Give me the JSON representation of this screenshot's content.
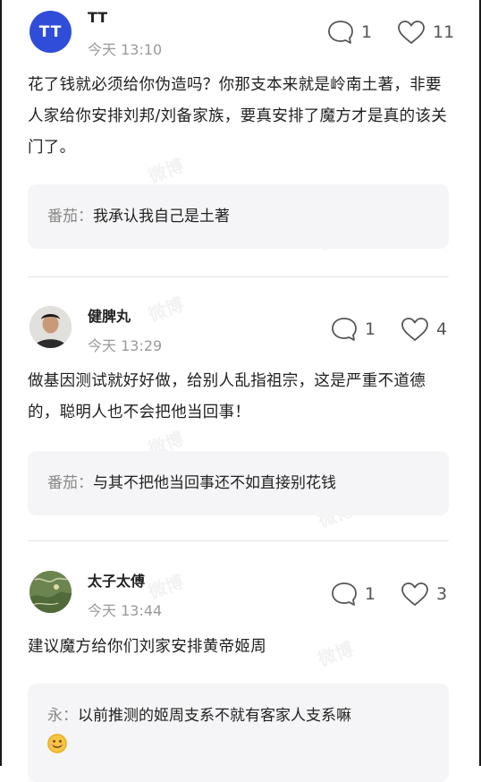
{
  "comments": [
    {
      "avatar_text": "TT",
      "username": "TT",
      "time": "今天 13:10",
      "reply_count": "1",
      "like_count": "11",
      "text": "花了钱就必须给你伪造吗？你那支本来就是岭南土著，非要人家给你安排刘邦/刘备家族，要真安排了魔方才是真的该关门了。",
      "reply": {
        "author": "番茄：",
        "text": "我承认我自己是土著"
      }
    },
    {
      "username": "健脾丸",
      "time": "今天 13:29",
      "reply_count": "1",
      "like_count": "4",
      "text": "做基因测试就好好做，给别人乱指祖宗，这是严重不道德的，聪明人也不会把他当回事！",
      "reply": {
        "author": "番茄：",
        "text": "与其不把他当回事还不如直接别花钱"
      }
    },
    {
      "username": "太子太傅",
      "time": "今天 13:44",
      "reply_count": "1",
      "like_count": "3",
      "text": "建议魔方给你们刘家安排黄帝姬周",
      "reply": {
        "author": "永：",
        "text": "以前推测的姬周支系不就有客家人支系嘛"
      }
    }
  ],
  "watermark_text": "微博",
  "icons": {
    "reply": "comment-bubble-icon",
    "like": "heart-icon",
    "emoji": "smile-emoji-icon"
  },
  "colors": {
    "avatar_blue": "#2f4dd8",
    "reply_bg": "#f5f5f7",
    "muted": "#9a9a9a"
  }
}
